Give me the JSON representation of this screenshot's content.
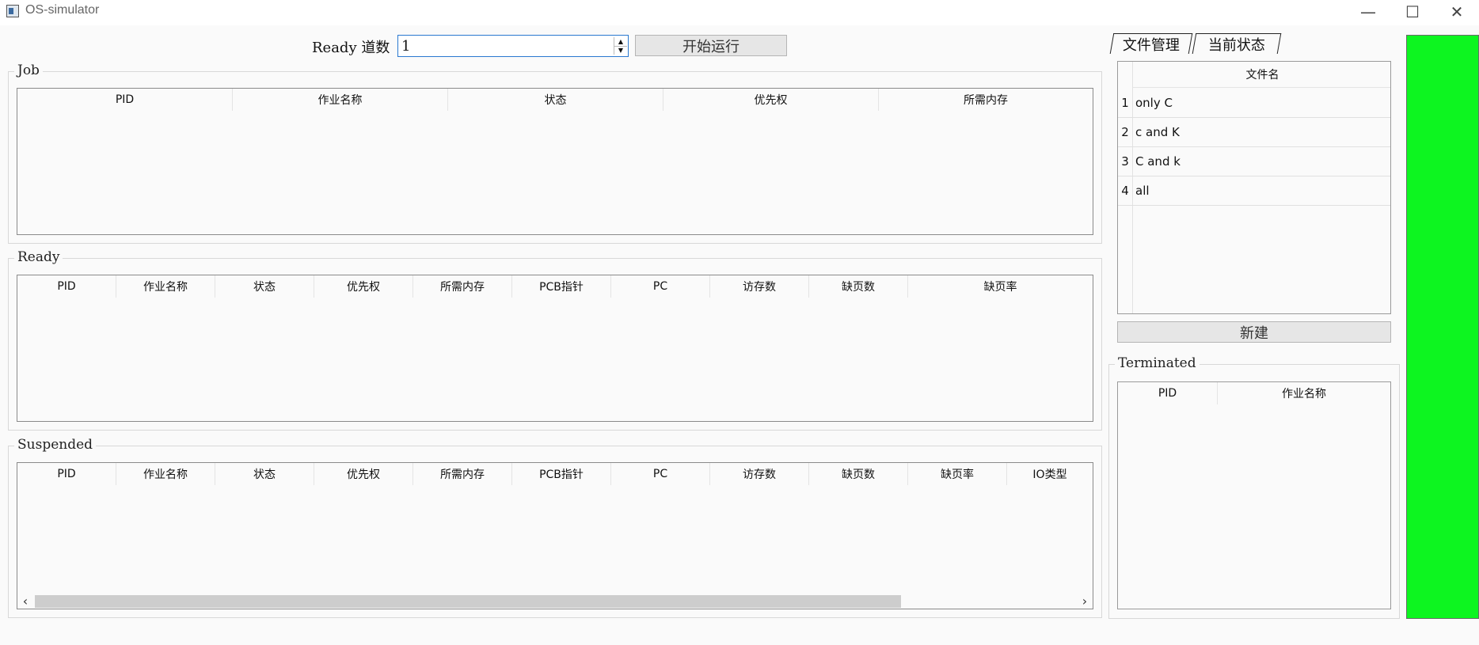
{
  "window": {
    "title": "OS-simulator",
    "controls": {
      "minimize": "—",
      "maximize": "☐",
      "close": "✕"
    }
  },
  "top": {
    "ready_label": "Ready 道数",
    "spin_value": "1",
    "start_button": "开始运行"
  },
  "job": {
    "title": "Job",
    "columns": [
      "PID",
      "作业名称",
      "状态",
      "优先权",
      "所需内存"
    ]
  },
  "ready": {
    "title": "Ready",
    "columns": [
      "PID",
      "作业名称",
      "状态",
      "优先权",
      "所需内存",
      "PCB指针",
      "PC",
      "访存数",
      "缺页数",
      "缺页率"
    ]
  },
  "suspended": {
    "title": "Suspended",
    "columns": [
      "PID",
      "作业名称",
      "状态",
      "优先权",
      "所需内存",
      "PCB指针",
      "PC",
      "访存数",
      "缺页数",
      "缺页率",
      "IO类型"
    ],
    "scroll_left": "‹",
    "scroll_right": "›"
  },
  "tabs": [
    "文件管理",
    "当前状态"
  ],
  "files": {
    "header": "文件名",
    "rows": [
      {
        "num": "1",
        "name": "only C"
      },
      {
        "num": "2",
        "name": "c and K"
      },
      {
        "num": "3",
        "name": "C and k"
      },
      {
        "num": "4",
        "name": "all"
      }
    ],
    "new_button": "新建"
  },
  "terminated": {
    "title": "Terminated",
    "columns": [
      "PID",
      "作业名称"
    ]
  },
  "colors": {
    "status_panel": "#0df520",
    "focus_border": "#2a78d0"
  }
}
